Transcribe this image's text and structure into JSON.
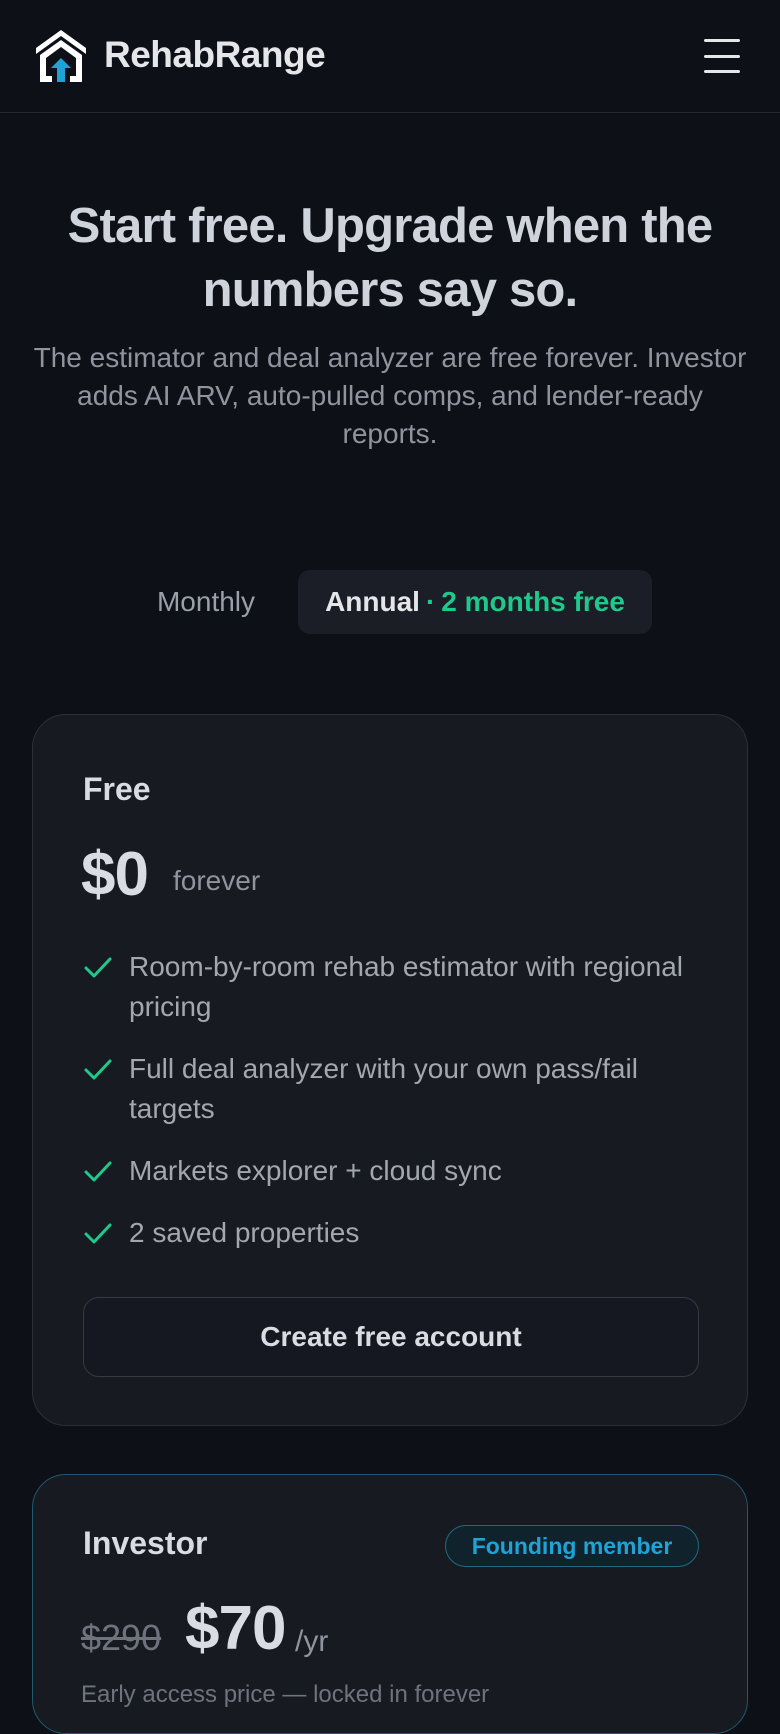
{
  "header": {
    "brand": "RehabRange",
    "logo_icon": "house-arrow-icon",
    "menu_icon": "hamburger-menu-icon"
  },
  "hero": {
    "title": "Start free. Upgrade when the numbers say so.",
    "subtitle": "The estimator and deal analyzer are free forever. Investor adds AI ARV, auto-pulled comps, and lender-ready reports."
  },
  "billing_toggle": {
    "monthly_label": "Monthly",
    "annual_label": "Annual",
    "separator": "·",
    "annual_note": "2 months free",
    "selected": "Annual"
  },
  "plans": {
    "free": {
      "name": "Free",
      "price": "$0",
      "period": "forever",
      "features": [
        "Room-by-room rehab estimator with regional pricing",
        "Full deal analyzer with your own pass/fail targets",
        "Markets explorer + cloud sync",
        "2 saved properties"
      ],
      "cta": "Create free account"
    },
    "investor": {
      "name": "Investor",
      "badge": "Founding member",
      "old_price": "$290",
      "price": "$70",
      "period": "/yr",
      "note": "Early access price — locked in forever"
    }
  },
  "colors": {
    "background": "#0d1017",
    "card": "#171a21",
    "accent_green": "#1fc98c",
    "accent_blue": "#1fa3d6"
  }
}
